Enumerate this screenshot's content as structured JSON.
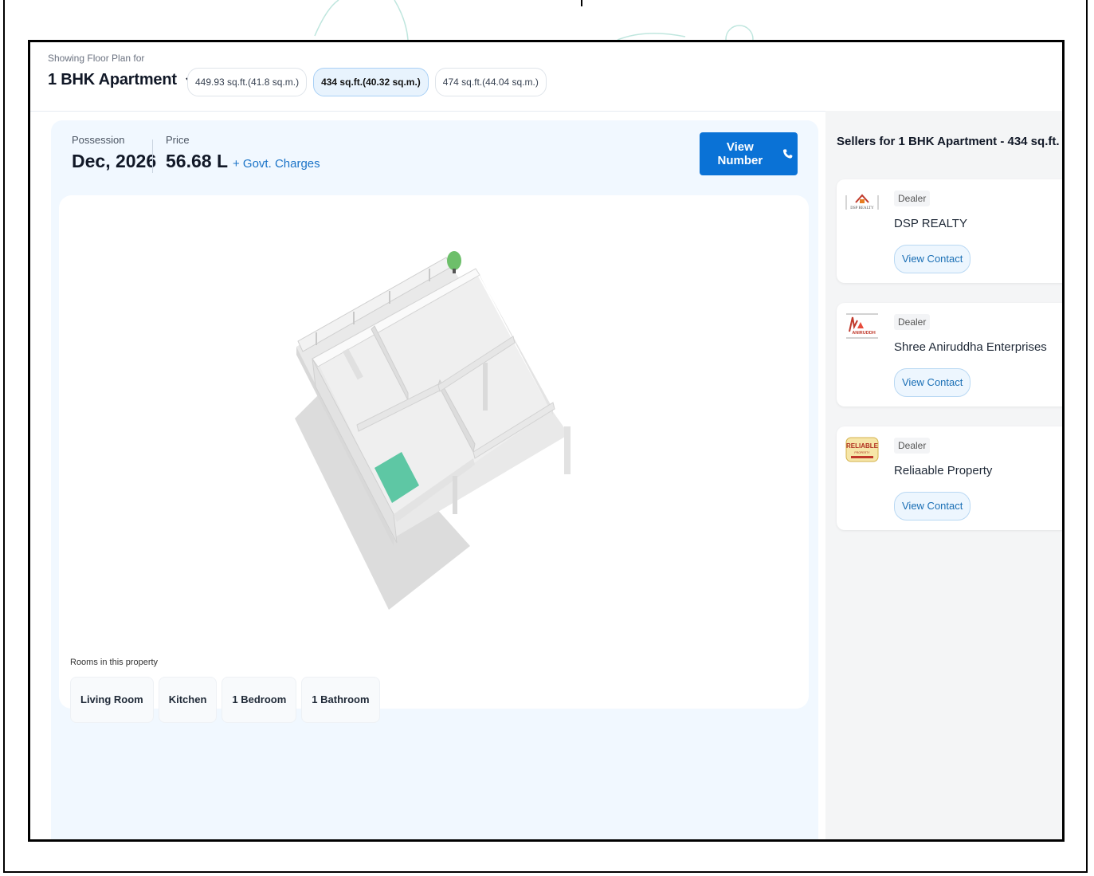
{
  "header": {
    "showing_label": "Showing Floor Plan for",
    "config_title": "1 BHK Apartment",
    "sizes": [
      {
        "label": "449.93 sq.ft.(41.8 sq.m.)",
        "active": false
      },
      {
        "label": "434 sq.ft.(40.32 sq.m.)",
        "active": true
      },
      {
        "label": "474 sq.ft.(44.04 sq.m.)",
        "active": false
      }
    ]
  },
  "summary": {
    "possession_label": "Possession",
    "possession_value": "Dec, 2026",
    "price_label": "Price",
    "price_value": "56.68 L",
    "govt_charges": "+ Govt. Charges",
    "view_number": "View Number"
  },
  "rooms": {
    "label": "Rooms in this property",
    "items": [
      "Living Room",
      "Kitchen",
      "1 Bedroom",
      "1 Bathroom"
    ]
  },
  "sellers": {
    "title": "Sellers for 1 BHK Apartment - 434 sq.ft.",
    "items": [
      {
        "type": "Dealer",
        "name": "DSP REALTY",
        "action": "View Contact",
        "logo_text": "DSP REALTY"
      },
      {
        "type": "Dealer",
        "name": "Shree Aniruddha Enterprises",
        "action": "View Contact",
        "logo_text": "ANIRUDDH"
      },
      {
        "type": "Dealer",
        "name": "Reliaable Property",
        "action": "View Contact",
        "logo_text": "RELIABLE"
      }
    ]
  },
  "colors": {
    "primary": "#0a72d6",
    "link": "#1a73c7",
    "accent_room": "#5ec7a4",
    "marker": "#6dbf6a"
  },
  "icons": [
    "chevron-down-icon",
    "phone-icon"
  ]
}
